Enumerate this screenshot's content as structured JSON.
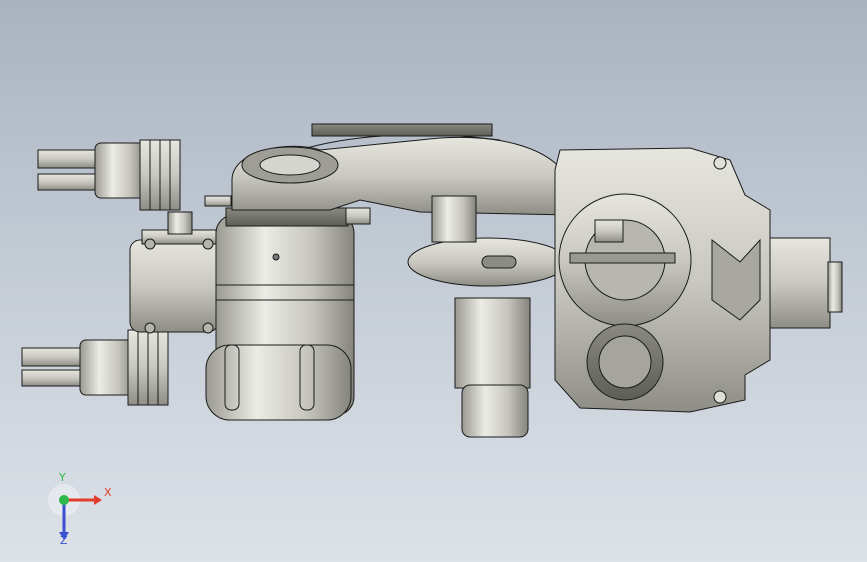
{
  "viewport": {
    "background_top": "#a9b3c0",
    "background_bottom": "#dde2e8",
    "part_color": "#c9c9c1",
    "edge_color": "#1a1a1a"
  },
  "triad": {
    "x_label": "X",
    "y_label": "Y",
    "z_label": "Z",
    "x_color": "#e23b2a",
    "y_color": "#2fb84a",
    "z_color": "#3b4fd0"
  }
}
